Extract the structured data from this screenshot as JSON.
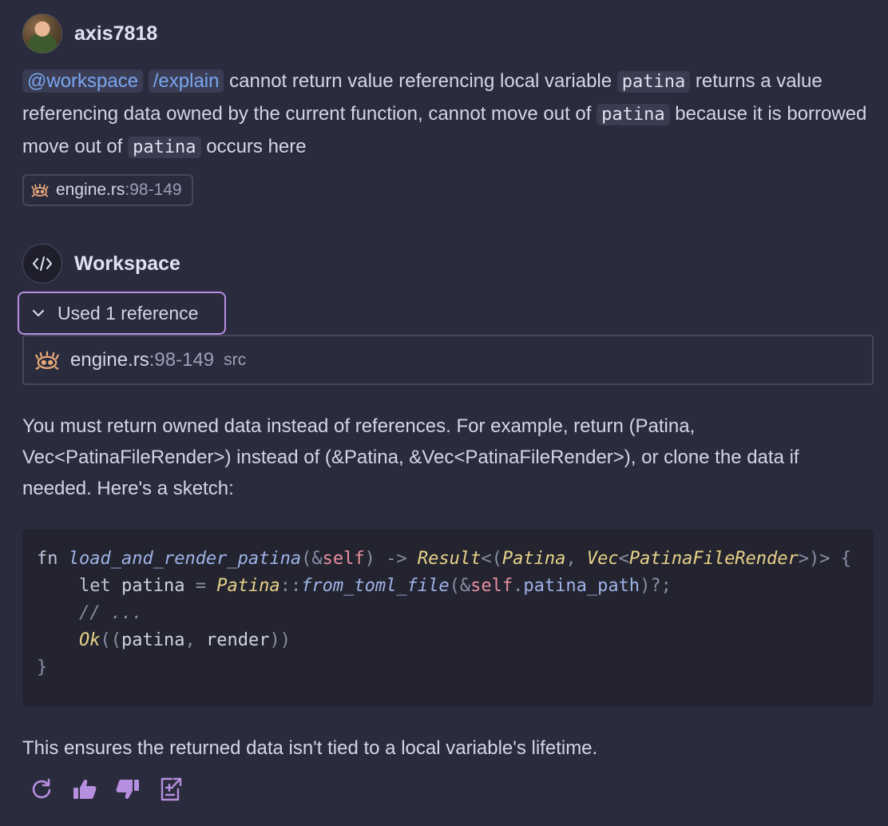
{
  "user": {
    "name": "axis7818"
  },
  "user_message": {
    "mention": "@workspace",
    "command": "/explain",
    "t1": " cannot return value referencing local variable ",
    "c1": "patina",
    "t2": " returns a value referencing data owned by the current function, cannot move out of ",
    "c2": "patina",
    "t3": " because it is borrowed move out of ",
    "c3": "patina",
    "t4": " occurs here"
  },
  "attachment": {
    "file": "engine.rs",
    "range": ":98-149"
  },
  "assistant": {
    "name": "Workspace"
  },
  "references": {
    "toggle_label": "Used 1 reference",
    "items": [
      {
        "file": "engine.rs",
        "range": ":98-149",
        "location": "src"
      }
    ]
  },
  "response": {
    "intro": "You must return owned data instead of references. For example, return (Patina, Vec<PatinaFileRender>) instead of (&Patina, &Vec<PatinaFileRender>), or clone the data if needed. Here's a sketch:",
    "code_lines": [
      "fn load_and_render_patina(&self) -> Result<(Patina, Vec<PatinaFileRender>)> {",
      "    let patina = Patina::from_toml_file(&self.patina_path)?;",
      "    // ...",
      "    Ok((patina, render))",
      "}"
    ],
    "outro": "This ensures the returned data isn't tied to a local variable's lifetime."
  },
  "actions": [
    {
      "name": "retry",
      "icon": "refresh-icon"
    },
    {
      "name": "helpful",
      "icon": "thumbs-up-icon"
    },
    {
      "name": "unhelpful",
      "icon": "thumbs-down-icon"
    },
    {
      "name": "insert-into-new-file",
      "icon": "insert-file-icon"
    }
  ],
  "colors": {
    "background": "#2a2b3d",
    "mention": "#7aa6f0",
    "accent_border": "#b78fe0",
    "code_bg": "#23242f"
  }
}
